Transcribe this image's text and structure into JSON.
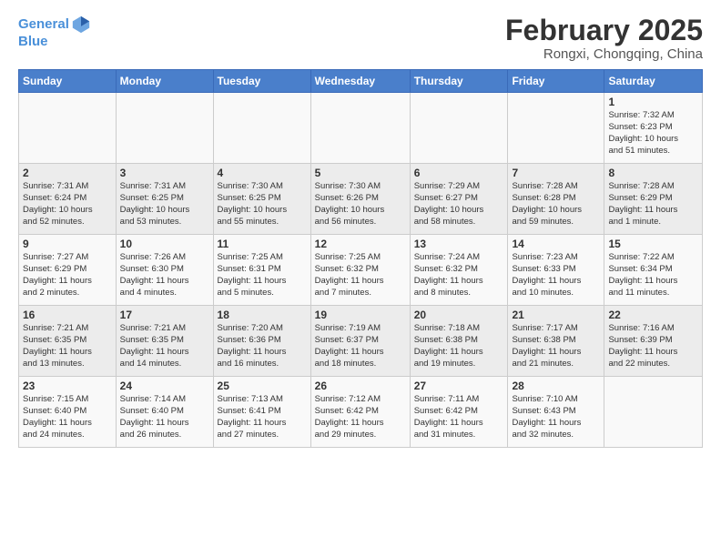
{
  "logo": {
    "line1": "General",
    "line2": "Blue",
    "icon": "▶"
  },
  "title": "February 2025",
  "subtitle": "Rongxi, Chongqing, China",
  "weekdays": [
    "Sunday",
    "Monday",
    "Tuesday",
    "Wednesday",
    "Thursday",
    "Friday",
    "Saturday"
  ],
  "weeks": [
    [
      {
        "day": "",
        "info": ""
      },
      {
        "day": "",
        "info": ""
      },
      {
        "day": "",
        "info": ""
      },
      {
        "day": "",
        "info": ""
      },
      {
        "day": "",
        "info": ""
      },
      {
        "day": "",
        "info": ""
      },
      {
        "day": "1",
        "info": "Sunrise: 7:32 AM\nSunset: 6:23 PM\nDaylight: 10 hours\nand 51 minutes."
      }
    ],
    [
      {
        "day": "2",
        "info": "Sunrise: 7:31 AM\nSunset: 6:24 PM\nDaylight: 10 hours\nand 52 minutes."
      },
      {
        "day": "3",
        "info": "Sunrise: 7:31 AM\nSunset: 6:25 PM\nDaylight: 10 hours\nand 53 minutes."
      },
      {
        "day": "4",
        "info": "Sunrise: 7:30 AM\nSunset: 6:25 PM\nDaylight: 10 hours\nand 55 minutes."
      },
      {
        "day": "5",
        "info": "Sunrise: 7:30 AM\nSunset: 6:26 PM\nDaylight: 10 hours\nand 56 minutes."
      },
      {
        "day": "6",
        "info": "Sunrise: 7:29 AM\nSunset: 6:27 PM\nDaylight: 10 hours\nand 58 minutes."
      },
      {
        "day": "7",
        "info": "Sunrise: 7:28 AM\nSunset: 6:28 PM\nDaylight: 10 hours\nand 59 minutes."
      },
      {
        "day": "8",
        "info": "Sunrise: 7:28 AM\nSunset: 6:29 PM\nDaylight: 11 hours\nand 1 minute."
      }
    ],
    [
      {
        "day": "9",
        "info": "Sunrise: 7:27 AM\nSunset: 6:29 PM\nDaylight: 11 hours\nand 2 minutes."
      },
      {
        "day": "10",
        "info": "Sunrise: 7:26 AM\nSunset: 6:30 PM\nDaylight: 11 hours\nand 4 minutes."
      },
      {
        "day": "11",
        "info": "Sunrise: 7:25 AM\nSunset: 6:31 PM\nDaylight: 11 hours\nand 5 minutes."
      },
      {
        "day": "12",
        "info": "Sunrise: 7:25 AM\nSunset: 6:32 PM\nDaylight: 11 hours\nand 7 minutes."
      },
      {
        "day": "13",
        "info": "Sunrise: 7:24 AM\nSunset: 6:32 PM\nDaylight: 11 hours\nand 8 minutes."
      },
      {
        "day": "14",
        "info": "Sunrise: 7:23 AM\nSunset: 6:33 PM\nDaylight: 11 hours\nand 10 minutes."
      },
      {
        "day": "15",
        "info": "Sunrise: 7:22 AM\nSunset: 6:34 PM\nDaylight: 11 hours\nand 11 minutes."
      }
    ],
    [
      {
        "day": "16",
        "info": "Sunrise: 7:21 AM\nSunset: 6:35 PM\nDaylight: 11 hours\nand 13 minutes."
      },
      {
        "day": "17",
        "info": "Sunrise: 7:21 AM\nSunset: 6:35 PM\nDaylight: 11 hours\nand 14 minutes."
      },
      {
        "day": "18",
        "info": "Sunrise: 7:20 AM\nSunset: 6:36 PM\nDaylight: 11 hours\nand 16 minutes."
      },
      {
        "day": "19",
        "info": "Sunrise: 7:19 AM\nSunset: 6:37 PM\nDaylight: 11 hours\nand 18 minutes."
      },
      {
        "day": "20",
        "info": "Sunrise: 7:18 AM\nSunset: 6:38 PM\nDaylight: 11 hours\nand 19 minutes."
      },
      {
        "day": "21",
        "info": "Sunrise: 7:17 AM\nSunset: 6:38 PM\nDaylight: 11 hours\nand 21 minutes."
      },
      {
        "day": "22",
        "info": "Sunrise: 7:16 AM\nSunset: 6:39 PM\nDaylight: 11 hours\nand 22 minutes."
      }
    ],
    [
      {
        "day": "23",
        "info": "Sunrise: 7:15 AM\nSunset: 6:40 PM\nDaylight: 11 hours\nand 24 minutes."
      },
      {
        "day": "24",
        "info": "Sunrise: 7:14 AM\nSunset: 6:40 PM\nDaylight: 11 hours\nand 26 minutes."
      },
      {
        "day": "25",
        "info": "Sunrise: 7:13 AM\nSunset: 6:41 PM\nDaylight: 11 hours\nand 27 minutes."
      },
      {
        "day": "26",
        "info": "Sunrise: 7:12 AM\nSunset: 6:42 PM\nDaylight: 11 hours\nand 29 minutes."
      },
      {
        "day": "27",
        "info": "Sunrise: 7:11 AM\nSunset: 6:42 PM\nDaylight: 11 hours\nand 31 minutes."
      },
      {
        "day": "28",
        "info": "Sunrise: 7:10 AM\nSunset: 6:43 PM\nDaylight: 11 hours\nand 32 minutes."
      },
      {
        "day": "",
        "info": ""
      }
    ]
  ]
}
